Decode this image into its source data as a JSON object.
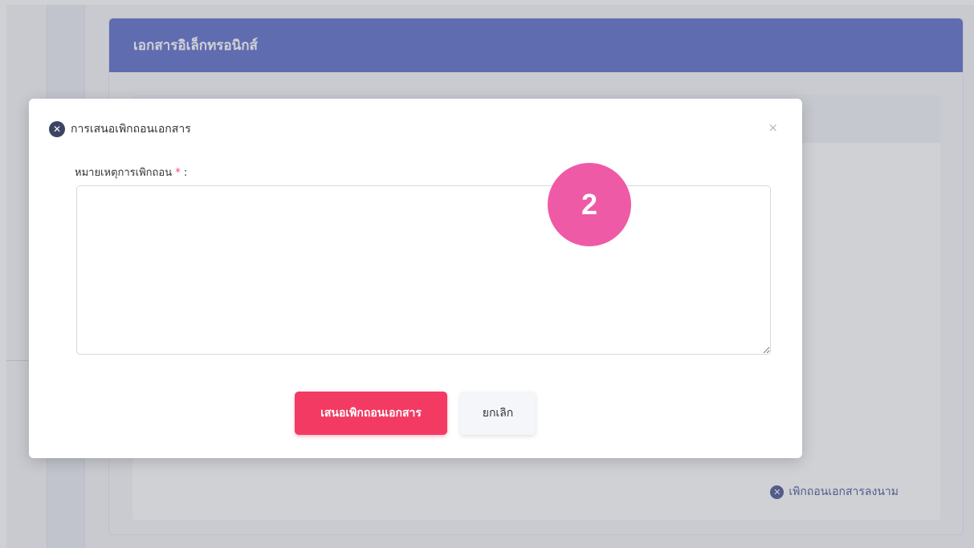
{
  "document_card": {
    "title": "เอกสารอิเล็กทรอนิกส์",
    "withdraw_signed_label": "เพิกถอนเอกสารลงนาม"
  },
  "modal": {
    "title": "การเสนอเพิกถอนเอกสาร",
    "close_symbol": "×",
    "field_label": "หมายเหตุการเพิกถอน",
    "required_mark": "*",
    "field_colon": " :",
    "reason_value": "",
    "submit_label": "เสนอเพิกถอนเอกสาร",
    "cancel_label": "ยกเลิก"
  },
  "step_badge": "2",
  "icons": {
    "title_icon": "circle-x-icon",
    "close_icon": "close-icon",
    "link_icon": "circle-x-icon"
  },
  "colors": {
    "header": "#5264c6",
    "submit": "#f23a63",
    "badge": "#ef5aa6",
    "required": "#f0456a"
  }
}
